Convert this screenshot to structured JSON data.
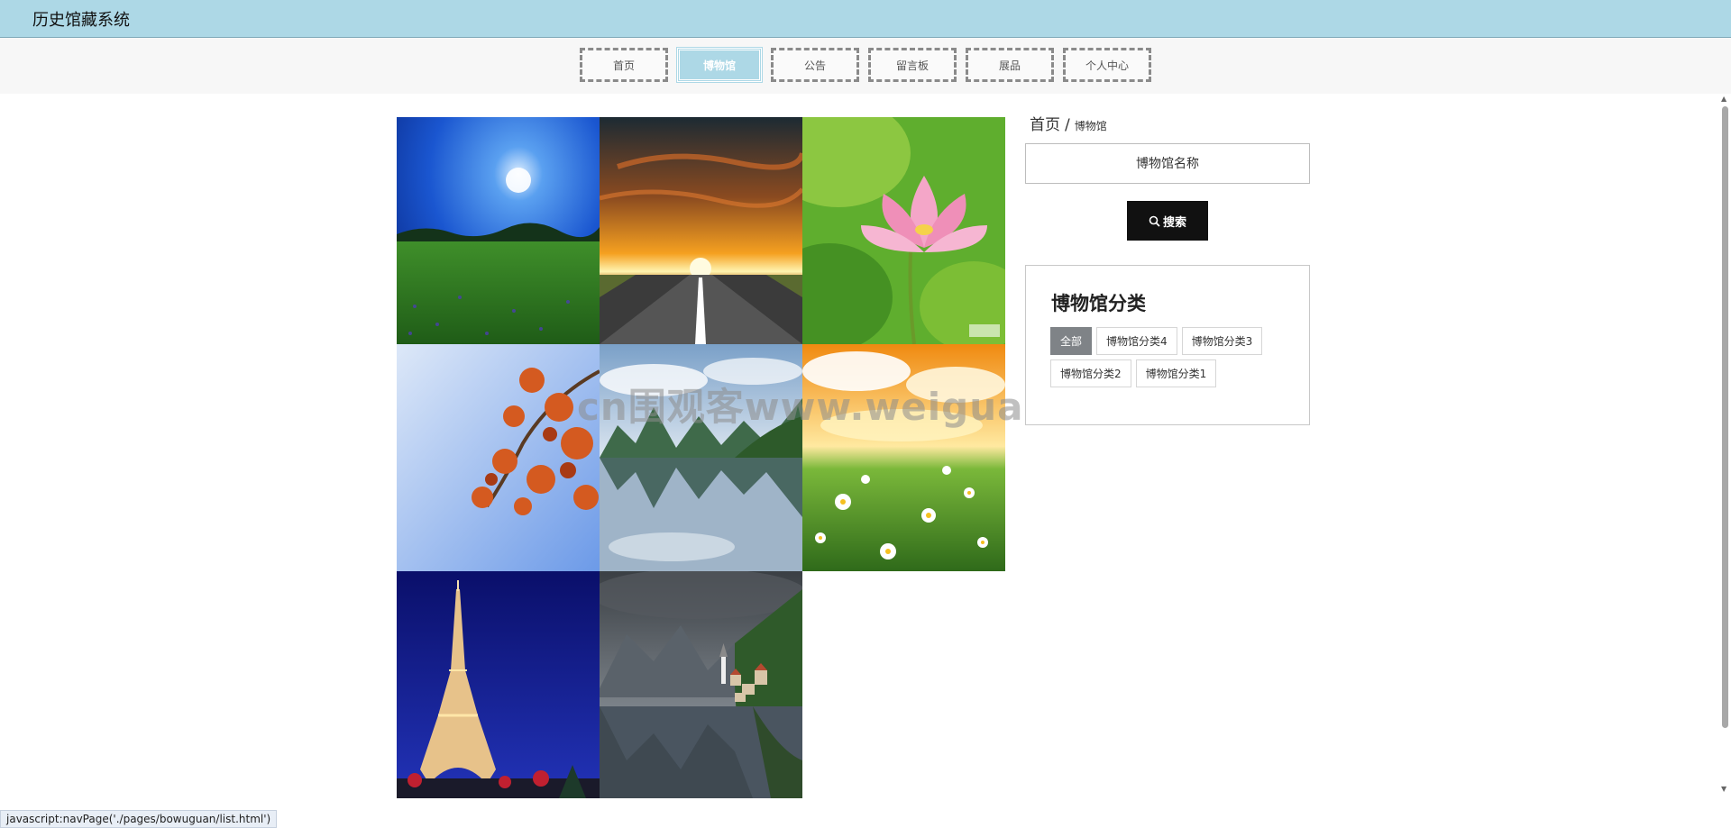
{
  "header": {
    "title": "历史馆藏系统"
  },
  "nav": {
    "items": [
      {
        "label": "首页",
        "active": false
      },
      {
        "label": "博物馆",
        "active": true
      },
      {
        "label": "公告",
        "active": false
      },
      {
        "label": "留言板",
        "active": false
      },
      {
        "label": "展品",
        "active": false
      },
      {
        "label": "个人中心",
        "active": false
      }
    ]
  },
  "breadcrumb": {
    "home": "首页",
    "separator": "/",
    "current": "博物馆"
  },
  "search": {
    "placeholder": "博物馆名称",
    "button_label": "搜索"
  },
  "categories": {
    "title": "博物馆分类",
    "tags": [
      {
        "label": "全部",
        "active": true
      },
      {
        "label": "博物馆分类4",
        "active": false
      },
      {
        "label": "博物馆分类3",
        "active": false
      },
      {
        "label": "博物馆分类2",
        "active": false
      },
      {
        "label": "博物馆分类1",
        "active": false
      }
    ]
  },
  "gallery": {
    "items": [
      {
        "image": "moon-meadow-photo",
        "caption": "",
        "badge": ""
      },
      {
        "image": "sunset-road-photo",
        "caption": "",
        "badge": ""
      },
      {
        "image": "lotus-flower-photo",
        "caption": "",
        "badge": ""
      },
      {
        "image": "autumn-leaves-photo",
        "caption": "",
        "badge": ""
      },
      {
        "image": "karst-lake-photo",
        "caption": "",
        "badge": ""
      },
      {
        "image": "daisy-field-photo",
        "caption": "",
        "badge": ""
      },
      {
        "image": "eiffel-tower-night-photo",
        "caption": "",
        "badge": ""
      },
      {
        "image": "hallstatt-lake-photo",
        "caption": "",
        "badge": ""
      }
    ]
  },
  "watermark": {
    "text": "cn围观客www.weiguanke.cn"
  },
  "status_bar": {
    "text": "javascript:navPage('./pages/bowuguan/list.html')"
  },
  "colors": {
    "header_bg": "#add8e6",
    "nav_active_bg": "#add8e6",
    "search_button_bg": "#111111",
    "tag_active_bg": "#7f8387"
  }
}
